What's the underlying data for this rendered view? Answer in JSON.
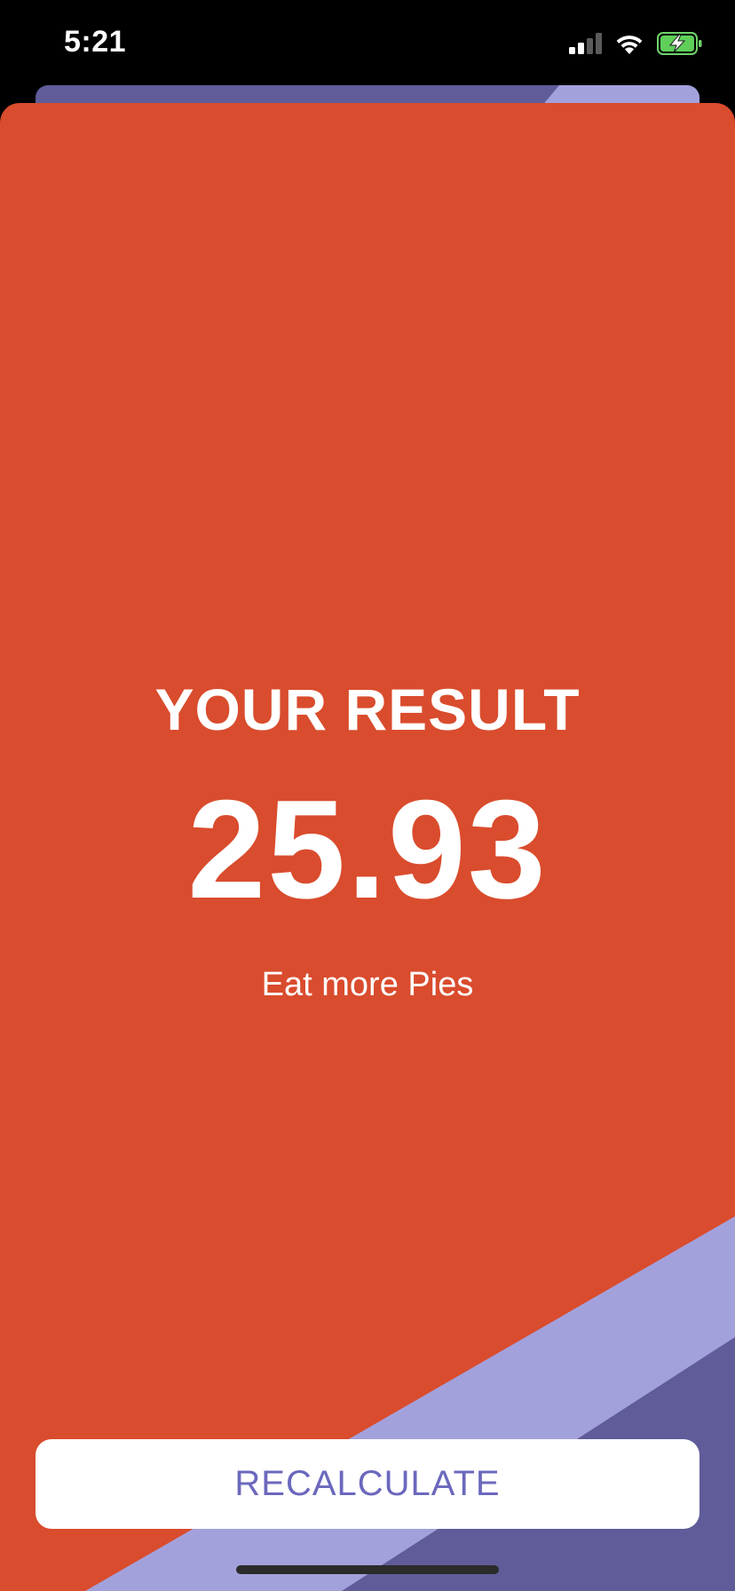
{
  "status_bar": {
    "time": "5:21",
    "icons": [
      "cellular-signal-icon",
      "wifi-icon",
      "battery-charging-icon"
    ]
  },
  "colors": {
    "sheet_background": "#d94c2d",
    "stripe_light": "#a3a1dc",
    "stripe_dark": "#5f5c99",
    "button_text": "#6b68bd"
  },
  "result": {
    "title": "YOUR RESULT",
    "value": "25.93",
    "message": "Eat more Pies"
  },
  "actions": {
    "recalculate_label": "RECALCULATE"
  }
}
